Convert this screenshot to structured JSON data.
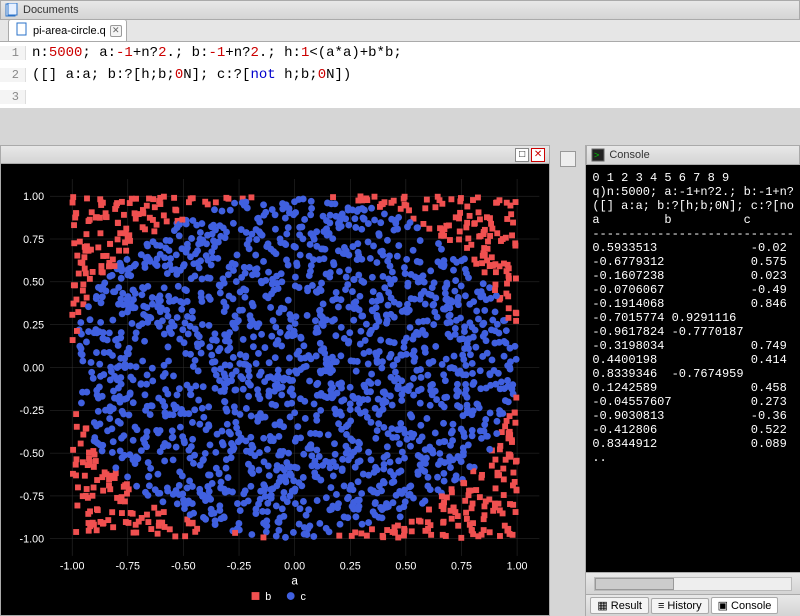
{
  "documents_pane": {
    "title": "Documents"
  },
  "tab": {
    "filename": "pi-area-circle.q"
  },
  "editor": {
    "lines": [
      {
        "n": "1",
        "code": "n:5000; a:-1+n?2.; b:-1+n?2.; h:1<(a*a)+b*b;"
      },
      {
        "n": "2",
        "code": "([] a:a; b:?[h;b;0N]; c:?[not h;b;0N])"
      },
      {
        "n": "3",
        "code": ""
      }
    ]
  },
  "chart_data": {
    "type": "scatter",
    "title": "",
    "xlabel": "a",
    "ylabel": "",
    "xlim": [
      -1.1,
      1.1
    ],
    "ylim": [
      -1.1,
      1.1
    ],
    "xticks": [
      -1.0,
      -0.75,
      -0.5,
      -0.25,
      0.0,
      0.25,
      0.5,
      0.75,
      1.0
    ],
    "yticks": [
      -1.0,
      -0.75,
      -0.5,
      -0.25,
      0.0,
      0.25,
      0.5,
      0.75,
      1.0
    ],
    "series": [
      {
        "name": "b",
        "color": "#f05050",
        "marker": "square",
        "region": "outside_unit_circle",
        "n_points": 1070
      },
      {
        "name": "c",
        "color": "#4060e0",
        "marker": "circle",
        "region": "inside_unit_circle",
        "n_points": 3930
      }
    ],
    "description": "5000 random points uniform in [-1,1]^2; series b (red squares) are points with a^2+b^2>1, series c (blue circles) are points with a^2+b^2<=1"
  },
  "legend": {
    "b": "b",
    "c": "c"
  },
  "console": {
    "title": "Console",
    "header_line": "0 1 2 3 4 5 6 7 8 9",
    "echo1": "q)n:5000; a:-1+n?2.; b:-1+n?",
    "echo2": "([] a:a; b:?[h;b;0N]; c:?[no",
    "cols": "a         b          c",
    "sep": "----------------------------",
    "rows": [
      {
        "a": "0.5933513",
        "b": "",
        "c": "-0.02"
      },
      {
        "a": "-0.6779312",
        "b": "",
        "c": "0.575"
      },
      {
        "a": "-0.1607238",
        "b": "",
        "c": "0.023"
      },
      {
        "a": "-0.0706067",
        "b": "",
        "c": "-0.49"
      },
      {
        "a": "-0.1914068",
        "b": "",
        "c": "0.846"
      },
      {
        "a": "-0.7015774",
        "b": "0.9291116",
        "c": ""
      },
      {
        "a": "-0.9617824",
        "b": "-0.7770187",
        "c": ""
      },
      {
        "a": "-0.3198034",
        "b": "",
        "c": "0.749"
      },
      {
        "a": "0.4400198",
        "b": "",
        "c": "0.414"
      },
      {
        "a": "0.8339346",
        "b": "-0.7674959",
        "c": ""
      },
      {
        "a": "0.1242589",
        "b": "",
        "c": "0.458"
      },
      {
        "a": "-0.04557607",
        "b": "",
        "c": "0.273"
      },
      {
        "a": "-0.9030813",
        "b": "",
        "c": "-0.36"
      },
      {
        "a": "-0.412806",
        "b": "",
        "c": "0.522"
      },
      {
        "a": "0.8344912",
        "b": "",
        "c": "0.089"
      }
    ],
    "continuation": ".."
  },
  "bottom_tabs": {
    "result": "Result",
    "history": "History",
    "console": "Console"
  }
}
